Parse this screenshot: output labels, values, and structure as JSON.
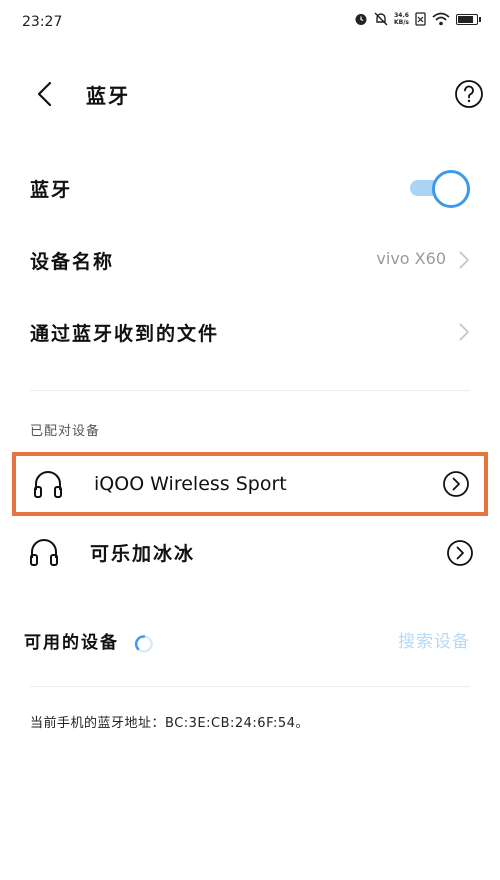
{
  "status_bar": {
    "time": "23:27",
    "net_speed_value": "34.6",
    "net_speed_unit": "KB/s",
    "battery_level": 0.85,
    "icons": [
      "alarm-icon",
      "mute-icon",
      "netspeed-icon",
      "sim-off-icon",
      "wifi-icon",
      "battery-icon"
    ]
  },
  "header": {
    "title": "蓝牙",
    "back_icon": "chevron-left-icon",
    "help_icon": "help-circle-icon"
  },
  "settings": {
    "bluetooth_label": "蓝牙",
    "bluetooth_enabled": true,
    "device_name_label": "设备名称",
    "device_name_value": "vivo X60",
    "received_files_label": "通过蓝牙收到的文件"
  },
  "paired": {
    "section_title": "已配对设备",
    "devices": [
      {
        "name": "iQOO Wireless Sport",
        "icon": "headphones-icon",
        "highlighted": true
      },
      {
        "name": "可乐加冰冰",
        "icon": "headphones-icon",
        "highlighted": false
      }
    ]
  },
  "available": {
    "section_title": "可用的设备",
    "search_label": "搜索设备"
  },
  "footer": {
    "address": "当前手机的蓝牙地址：BC:3E:CB:24:6F:54。"
  },
  "colors": {
    "accent": "#3c9ae8",
    "toggle_track": "#a9d4f5",
    "highlight_border": "#e5743f",
    "search_disabled": "#b9d8f2"
  }
}
